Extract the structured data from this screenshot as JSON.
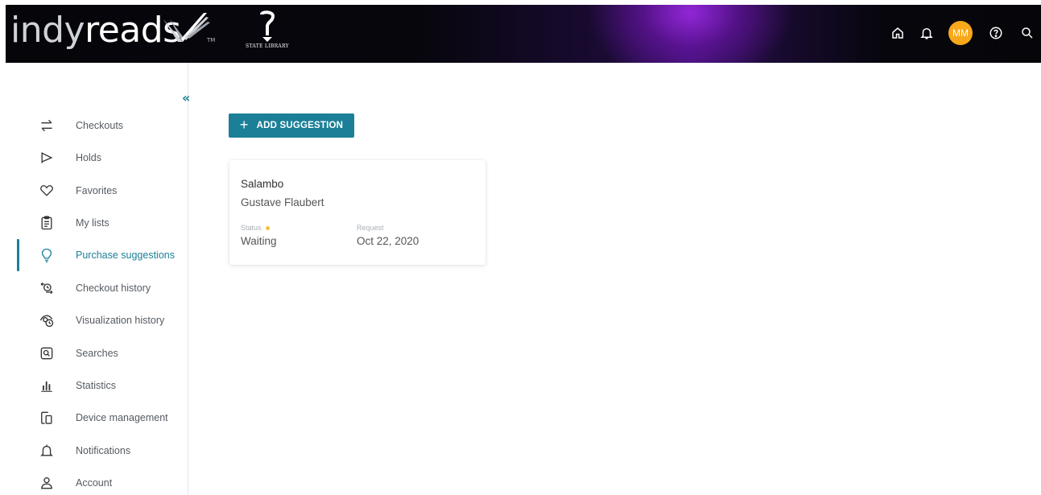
{
  "header": {
    "logo_indy": "indy",
    "logo_reads": "reads",
    "logo_tm": "TM",
    "library_name": "STATE LIBRARY",
    "icons": [
      "home-icon",
      "bell-icon",
      "avatar",
      "help-icon",
      "search-icon"
    ],
    "avatar_initials": "MM",
    "avatar_color": "#f7a81b"
  },
  "sidebar": {
    "collapse_icon": "double-chevron-left-icon",
    "accent_color": "#1b7f97",
    "items": [
      {
        "label": "Checkouts",
        "icon": "swap-arrows-icon"
      },
      {
        "label": "Holds",
        "icon": "flag-icon"
      },
      {
        "label": "Favorites",
        "icon": "heart-icon"
      },
      {
        "label": "My lists",
        "icon": "clipboard-list-icon"
      },
      {
        "label": "Purchase suggestions",
        "icon": "lightbulb-icon",
        "active": true
      },
      {
        "label": "Checkout history",
        "icon": "checkout-history-icon"
      },
      {
        "label": "Visualization history",
        "icon": "visualization-history-icon"
      },
      {
        "label": "Searches",
        "icon": "search-box-icon"
      },
      {
        "label": "Statistics",
        "icon": "bar-chart-icon"
      },
      {
        "label": "Device management",
        "icon": "devices-icon"
      },
      {
        "label": "Notifications",
        "icon": "bell-icon"
      },
      {
        "label": "Account",
        "icon": "user-icon"
      }
    ]
  },
  "main": {
    "add_button_label": "ADD SUGGESTION",
    "add_button_icon": "plus-icon",
    "suggestions": [
      {
        "title": "Salambo",
        "author": "Gustave Flaubert",
        "status_label": "Status",
        "status_value": "Waiting",
        "request_label": "Request",
        "request_value": "Oct 22, 2020"
      }
    ]
  }
}
